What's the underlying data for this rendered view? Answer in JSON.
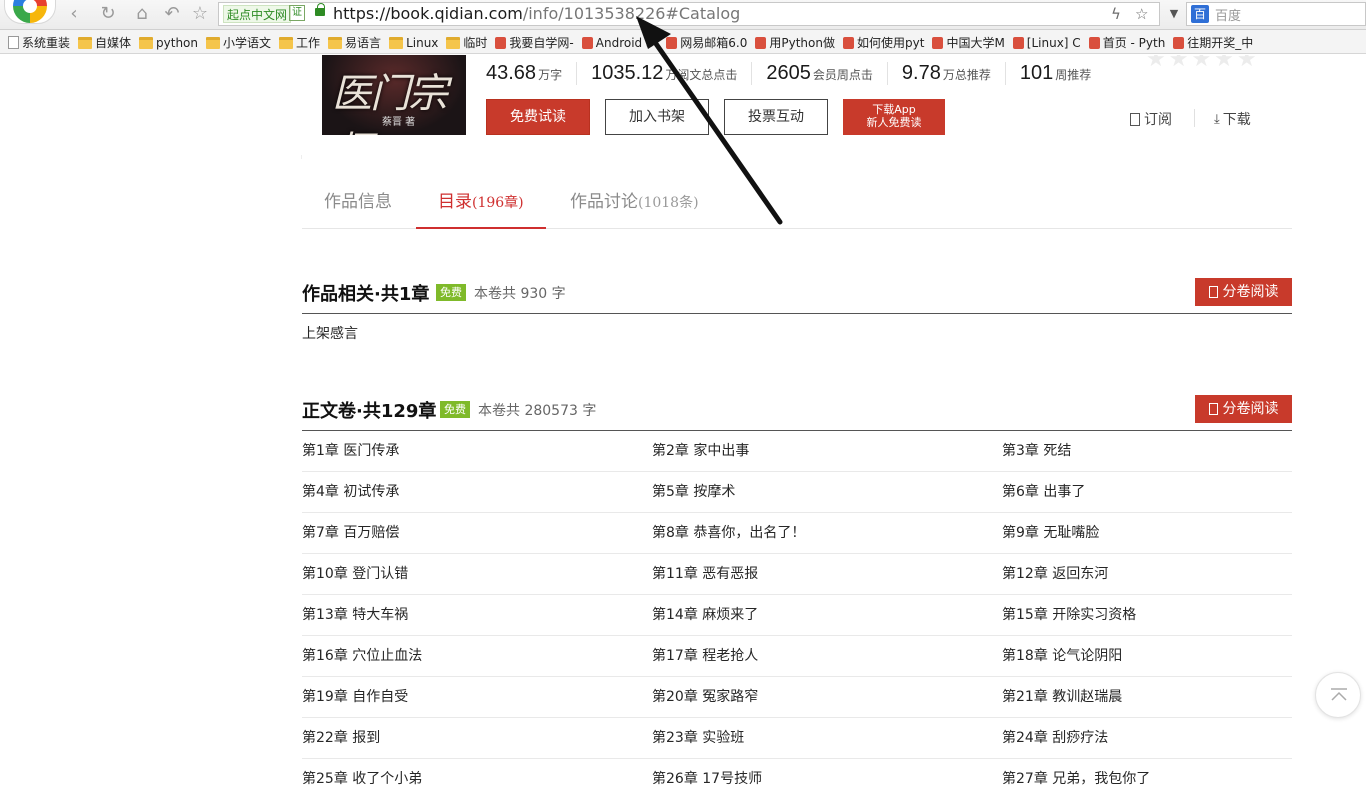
{
  "browser": {
    "site_badge": "起点中文网",
    "cert_label": "证",
    "url_host": "https://book.qidian.com",
    "url_path": "/info/1013538226#Catalog",
    "search_placeholder": "百度",
    "search_engine_label": "百",
    "bookmarks": [
      {
        "icon": "page-icon",
        "label": "系统重装"
      },
      {
        "icon": "folder-icon",
        "label": "自媒体"
      },
      {
        "icon": "folder-icon",
        "label": "python"
      },
      {
        "icon": "folder-icon",
        "label": "小学语文"
      },
      {
        "icon": "folder-icon",
        "label": "工作"
      },
      {
        "icon": "folder-icon",
        "label": "易语言"
      },
      {
        "icon": "folder-icon",
        "label": "Linux"
      },
      {
        "icon": "folder-icon",
        "label": "临时"
      },
      {
        "icon": "site-icon",
        "label": "我要自学网-"
      },
      {
        "icon": "site-icon",
        "label": "Android St"
      },
      {
        "icon": "site-icon",
        "label": "网易邮箱6.0"
      },
      {
        "icon": "site-icon",
        "label": "用Python做"
      },
      {
        "icon": "site-icon",
        "label": "如何使用pyt"
      },
      {
        "icon": "site-icon",
        "label": "中国大学M"
      },
      {
        "icon": "site-icon",
        "label": "[Linux] C"
      },
      {
        "icon": "site-icon",
        "label": "首页 - Pyth"
      },
      {
        "icon": "site-icon",
        "label": "往期开奖_中"
      }
    ]
  },
  "book": {
    "cover_title": "医门宗师",
    "cover_author": "蔡晋 著",
    "stats": [
      {
        "num": "43.68",
        "unit": "万字"
      },
      {
        "num": "1035.12",
        "unit": "万阅文总点击"
      },
      {
        "num": "2605",
        "unit": "会员周点击"
      },
      {
        "num": "9.78",
        "unit": "万总推荐"
      },
      {
        "num": "101",
        "unit": "周推荐"
      }
    ],
    "buttons": {
      "read_free": "免费试读",
      "add_shelf": "加入书架",
      "vote": "投票互动",
      "app_line1": "下载App",
      "app_line2": "新人免费读"
    },
    "subscribe": "订阅",
    "download": "下载"
  },
  "tabs": [
    {
      "label": "作品信息",
      "count": ""
    },
    {
      "label": "目录",
      "count": "(196章)"
    },
    {
      "label": "作品讨论",
      "count": "(1018条)"
    }
  ],
  "volumes": [
    {
      "title": "作品相关·共1章",
      "free": "免费",
      "count": "本卷共 930 字",
      "read_button": "分卷阅读",
      "chapters": [
        "上架感言"
      ]
    },
    {
      "title": "正文卷·共129章",
      "free": "免费",
      "count": "本卷共 280573 字",
      "read_button": "分卷阅读",
      "chapters": [
        "第1章  医门传承",
        "第2章  家中出事",
        "第3章  死结",
        "第4章  初试传承",
        "第5章  按摩术",
        "第6章  出事了",
        "第7章  百万赔偿",
        "第8章  恭喜你，出名了！",
        "第9章  无耻嘴脸",
        "第10章  登门认错",
        "第11章  恶有恶报",
        "第12章  返回东河",
        "第13章  特大车祸",
        "第14章  麻烦来了",
        "第15章  开除实习资格",
        "第16章  穴位止血法",
        "第17章  程老抢人",
        "第18章  论气论阴阳",
        "第19章  自作自受",
        "第20章  冤家路窄",
        "第21章  教训赵瑞晨",
        "第22章  报到",
        "第23章  实验班",
        "第24章  刮痧疗法",
        "第25章  收了个小弟",
        "第26章  17号技师",
        "第27章  兄弟，我包你了"
      ]
    }
  ],
  "colors": {
    "accent_red": "#c83a2b",
    "tab_active": "#cf2f2f",
    "free_badge": "#7fba2a"
  }
}
